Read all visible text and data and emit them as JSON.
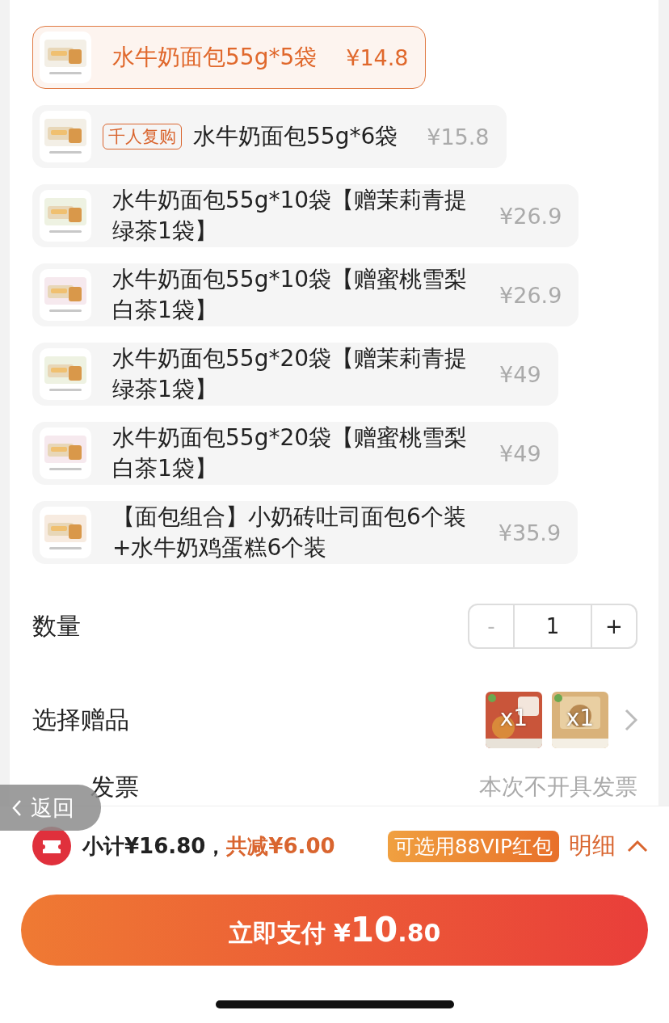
{
  "options": [
    {
      "lines": [
        "水牛奶面包55g*5袋"
      ],
      "price": "¥14.8",
      "selected": true
    },
    {
      "tag": "千人复购",
      "lines": [
        "水牛奶面包55g*6袋"
      ],
      "price": "¥15.8",
      "selected": false
    },
    {
      "lines": [
        "水牛奶面包55g*10袋【赠茉莉青提",
        "绿茶1袋】"
      ],
      "price": "¥26.9",
      "selected": false
    },
    {
      "lines": [
        "水牛奶面包55g*10袋【赠蜜桃雪梨",
        "白茶1袋】"
      ],
      "price": "¥26.9",
      "selected": false
    },
    {
      "lines": [
        "水牛奶面包55g*20袋【赠茉莉青提",
        "绿茶1袋】"
      ],
      "price": "¥49",
      "selected": false
    },
    {
      "lines": [
        "水牛奶面包55g*20袋【赠蜜桃雪梨",
        "白茶1袋】"
      ],
      "price": "¥49",
      "selected": false
    },
    {
      "lines": [
        "【面包组合】小奶砖吐司面包6个装",
        "+水牛奶鸡蛋糕6个装"
      ],
      "price": "¥35.9",
      "selected": false
    }
  ],
  "quantity": {
    "label": "数量",
    "minus": "-",
    "value": "1",
    "plus": "+"
  },
  "gifts": {
    "label": "选择赠品",
    "items": [
      {
        "count": "x1"
      },
      {
        "count": "x1"
      }
    ]
  },
  "invoice": {
    "label": "发票",
    "value": "本次不开具发票"
  },
  "back_button": {
    "label": "返回"
  },
  "summary": {
    "subtotal": "小计¥16.80，",
    "discount": "共减¥6.00",
    "badge": "可选用88VIP红包",
    "details": "明细"
  },
  "pay_button": {
    "label": "立即支付 ¥**10**.80"
  }
}
